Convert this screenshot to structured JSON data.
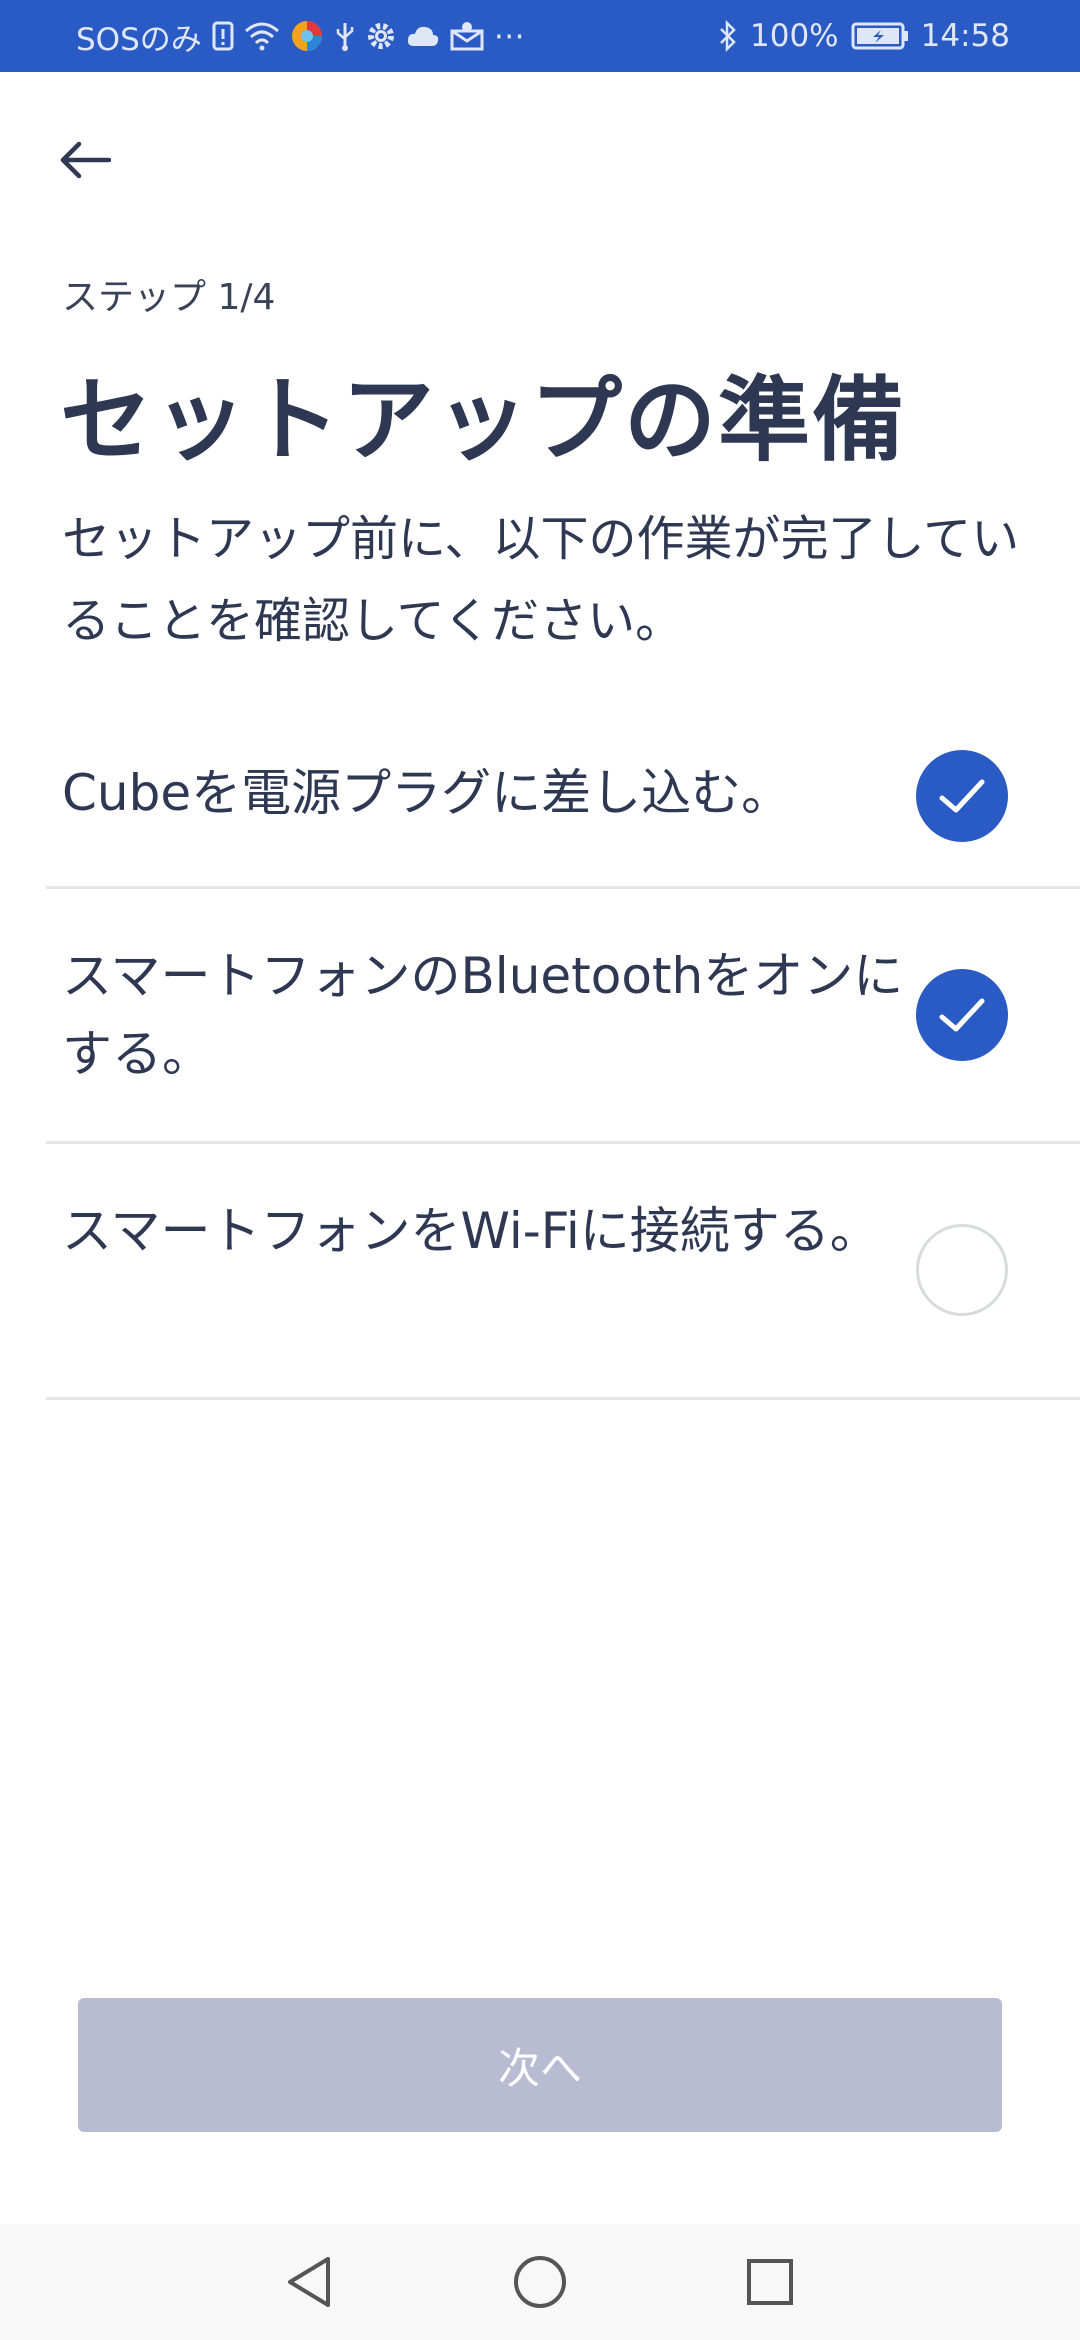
{
  "status_bar": {
    "carrier": "SOSのみ",
    "battery": "100%",
    "time": "14:58",
    "icons": [
      "sim-alert-icon",
      "wifi-icon",
      "browser-icon",
      "usb-icon",
      "settings-icon",
      "cloud-icon",
      "mail-icon",
      "more-icon",
      "bluetooth-icon",
      "battery-charging-icon"
    ]
  },
  "header": {
    "back_icon": "arrow-left-icon"
  },
  "step_label": "ステップ 1/4",
  "title": "セットアップの準備",
  "subtitle": "セットアップ前に、以下の作業が完了していることを確認してください。",
  "checklist": [
    {
      "label": "Cubeを電源プラグに差し込む。",
      "checked": true
    },
    {
      "label": "スマートフォンのBluetoothをオンにする。",
      "checked": true
    },
    {
      "label": "スマートフォンをWi-Fiに接続する。",
      "checked": false
    }
  ],
  "next_button": {
    "label": "次へ",
    "enabled": false
  },
  "colors": {
    "accent": "#2a5bc5",
    "text": "#2f3852",
    "disabled_button": "#b8bbd1",
    "divider": "#e4e6ea"
  },
  "nav_bar": {
    "icons": [
      "back-triangle-icon",
      "home-circle-icon",
      "recents-square-icon"
    ]
  }
}
